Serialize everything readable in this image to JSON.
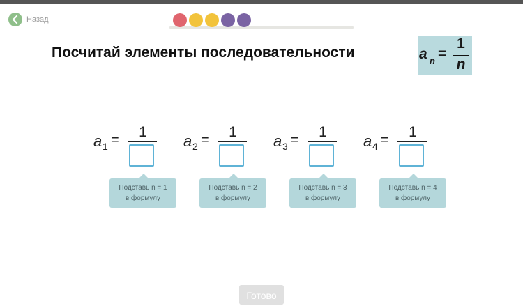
{
  "nav": {
    "back_label": "Назад"
  },
  "progress": {
    "dot_colors": [
      "#e0656e",
      "#f2c33b",
      "#f2c33b",
      "#7a63a3",
      "#7a63a3"
    ]
  },
  "title": "Посчитай элементы последовательности",
  "formula": {
    "symbol": "a",
    "subscript": "n",
    "equals": "=",
    "numerator": "1",
    "denominator": "n"
  },
  "terms": [
    {
      "symbol": "a",
      "index": "1",
      "equals": "=",
      "numerator": "1",
      "input_value": "",
      "hint_line1": "Подставь n = 1",
      "hint_line2": "в формулу"
    },
    {
      "symbol": "a",
      "index": "2",
      "equals": "=",
      "numerator": "1",
      "input_value": "",
      "hint_line1": "Подставь n = 2",
      "hint_line2": "в формулу"
    },
    {
      "symbol": "a",
      "index": "3",
      "equals": "=",
      "numerator": "1",
      "input_value": "",
      "hint_line1": "Подставь n = 3",
      "hint_line2": "в формулу"
    },
    {
      "symbol": "a",
      "index": "4",
      "equals": "=",
      "numerator": "1",
      "input_value": "",
      "hint_line1": "Подставь n = 4",
      "hint_line2": "в формулу"
    }
  ],
  "done_label": "Готово"
}
